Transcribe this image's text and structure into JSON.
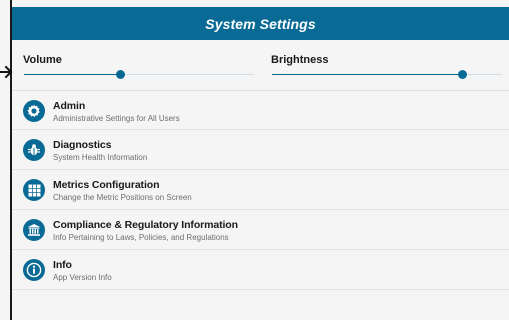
{
  "header": {
    "title": "System Settings"
  },
  "sliders": [
    {
      "label": "Volume",
      "level": 0.42
    },
    {
      "label": "Brightness",
      "level": 0.83
    }
  ],
  "menu": [
    {
      "title": "Admin",
      "subtitle": "Administrative Settings for All Users",
      "icon": "gear-icon"
    },
    {
      "title": "Diagnostics",
      "subtitle": "System Health Information",
      "icon": "bug-icon"
    },
    {
      "title": "Metrics Configuration",
      "subtitle": "Change the Metric Positions on Screen",
      "icon": "grid-icon"
    },
    {
      "title": "Compliance & Regulatory Information",
      "subtitle": "Info Pertaining to Laws, Policies, and Regulations",
      "icon": "institution-icon"
    },
    {
      "title": "Info",
      "subtitle": "App Version Info",
      "icon": "info-icon"
    }
  ],
  "colors": {
    "accent": "#0a6a96",
    "background": "#f5f5f5",
    "divider": "#e0e0e0"
  }
}
